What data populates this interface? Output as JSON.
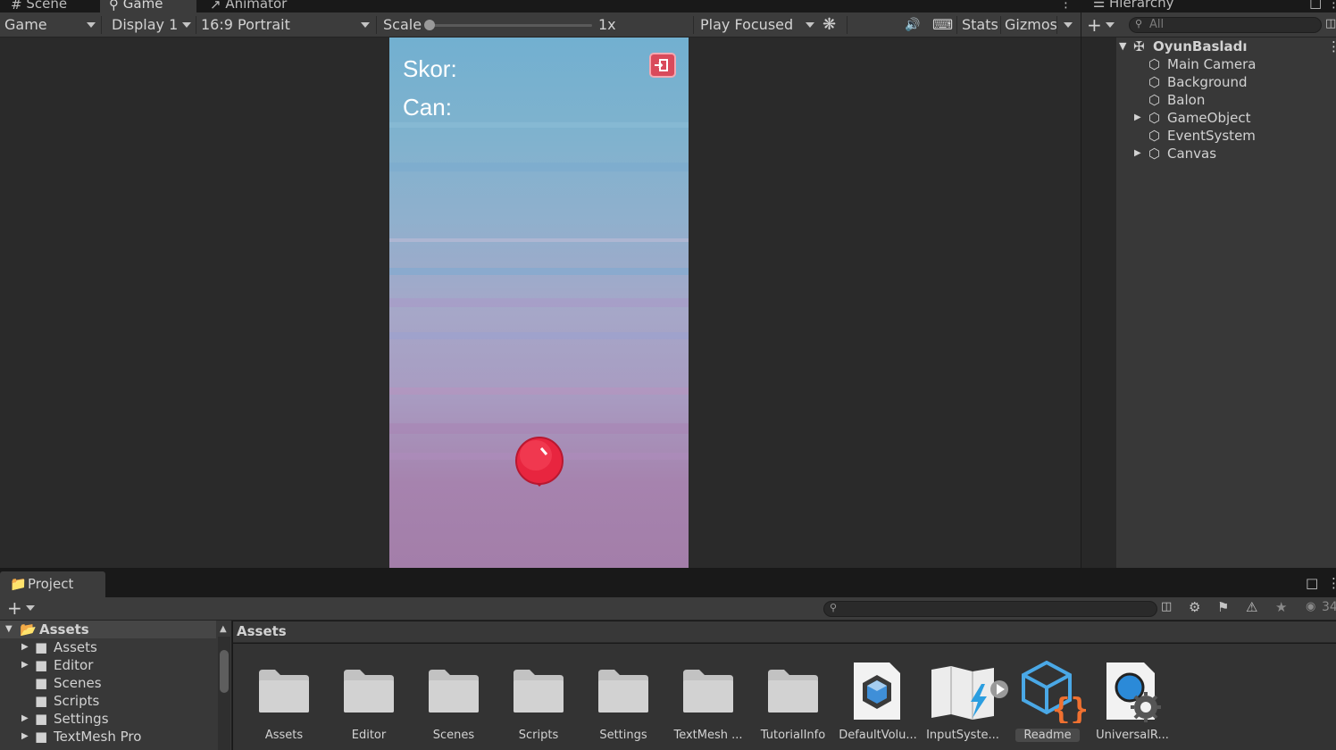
{
  "tabs": [
    {
      "label": "Scene",
      "icon": "hash-icon"
    },
    {
      "label": "Game",
      "icon": "gamepad-icon",
      "active": true
    },
    {
      "label": "Animator",
      "icon": "animator-icon"
    }
  ],
  "toolbar": {
    "view_select": "Game",
    "display_select": "Display 1",
    "aspect_select": "16:9 Portrait",
    "scale_label": "Scale",
    "scale_value": "1x",
    "scale_level": 0,
    "play_mode": "Play Focused",
    "stats_label": "Stats",
    "gizmos_label": "Gizmos"
  },
  "game": {
    "score_label": "Skor:",
    "lives_label": "Can:"
  },
  "hierarchy": {
    "tab_label": "Hierarchy",
    "search_placeholder": "All",
    "scene_name": "OyunBasladı",
    "items": [
      {
        "label": "Main Camera",
        "expandable": false
      },
      {
        "label": "Background",
        "expandable": false
      },
      {
        "label": "Balon",
        "expandable": false
      },
      {
        "label": "GameObject",
        "expandable": true
      },
      {
        "label": "EventSystem",
        "expandable": false
      },
      {
        "label": "Canvas",
        "expandable": true
      }
    ]
  },
  "project": {
    "tab_label": "Project",
    "breadcrumb": "Assets",
    "hidden_count": "34",
    "tree": [
      {
        "label": "Assets",
        "level": 0,
        "expanded": true,
        "bold": true
      },
      {
        "label": "Assets",
        "level": 1,
        "expandable": true
      },
      {
        "label": "Editor",
        "level": 1,
        "expandable": true
      },
      {
        "label": "Scenes",
        "level": 1,
        "expandable": false
      },
      {
        "label": "Scripts",
        "level": 1,
        "expandable": false
      },
      {
        "label": "Settings",
        "level": 1,
        "expandable": true
      },
      {
        "label": "TextMesh Pro",
        "level": 1,
        "expandable": true
      }
    ],
    "assets": [
      {
        "label": "Assets",
        "kind": "folder"
      },
      {
        "label": "Editor",
        "kind": "folder"
      },
      {
        "label": "Scenes",
        "kind": "folder"
      },
      {
        "label": "Scripts",
        "kind": "folder"
      },
      {
        "label": "Settings",
        "kind": "folder"
      },
      {
        "label": "TextMesh ...",
        "kind": "folder"
      },
      {
        "label": "TutorialInfo",
        "kind": "folder"
      },
      {
        "label": "DefaultVolu...",
        "kind": "volume-profile"
      },
      {
        "label": "InputSyste...",
        "kind": "input-actions"
      },
      {
        "label": "Readme",
        "kind": "readme",
        "selected": true
      },
      {
        "label": "UniversalR...",
        "kind": "render-pipeline"
      }
    ]
  }
}
